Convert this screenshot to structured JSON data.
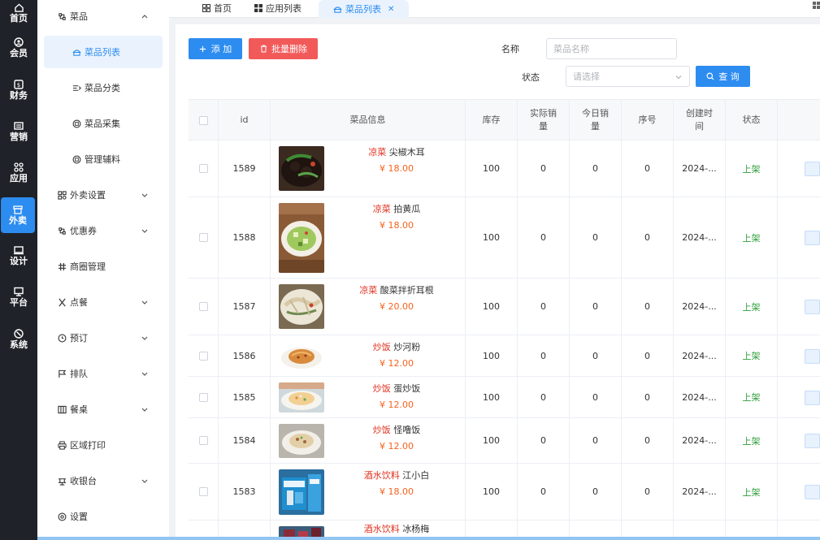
{
  "rail": [
    {
      "label": "首页",
      "icon": "home-icon"
    },
    {
      "label": "会员",
      "icon": "member-icon"
    },
    {
      "label": "财务",
      "icon": "finance-icon"
    },
    {
      "label": "营销",
      "icon": "marketing-icon"
    },
    {
      "label": "应用",
      "icon": "apps-icon"
    },
    {
      "label": "外卖",
      "icon": "takeout-icon",
      "active": true
    },
    {
      "label": "设计",
      "icon": "design-icon"
    },
    {
      "label": "平台",
      "icon": "platform-icon"
    },
    {
      "label": "系统",
      "icon": "system-icon"
    }
  ],
  "menu": {
    "group_dishes": "菜品",
    "sub": [
      "菜品列表",
      "菜品分类",
      "菜品采集",
      "管理辅料"
    ],
    "items": [
      "外卖设置",
      "优惠券",
      "商圈管理",
      "点餐",
      "预订",
      "排队",
      "餐桌",
      "区域打印",
      "收银台",
      "设置"
    ]
  },
  "tabs": [
    "首页",
    "应用列表",
    "菜品列表"
  ],
  "toolbar": {
    "add_label": "添 加",
    "batch_delete_label": "批量删除",
    "name_label": "名称",
    "name_placeholder": "菜品名称",
    "status_label": "状态",
    "status_placeholder": "请选择",
    "query_label": "查 询"
  },
  "table": {
    "headers": {
      "id": "id",
      "info": "菜品信息",
      "stock": "库存",
      "actual_sales": "实际销量",
      "today_sales": "今日销量",
      "sort": "序号",
      "created": "创建时间",
      "status": "状态"
    },
    "rows": [
      {
        "id": "1589",
        "category": "凉菜",
        "name": "尖椒木耳",
        "price": "¥ 18.00",
        "stock": "100",
        "actual": "0",
        "today": "0",
        "sort": "0",
        "created": "2024-...",
        "status": "上架"
      },
      {
        "id": "1588",
        "category": "凉菜",
        "name": "拍黄瓜",
        "price": "¥ 18.00",
        "stock": "100",
        "actual": "0",
        "today": "0",
        "sort": "0",
        "created": "2024-...",
        "status": "上架"
      },
      {
        "id": "1587",
        "category": "凉菜",
        "name": "酸菜拌折耳根",
        "price": "¥ 20.00",
        "stock": "100",
        "actual": "0",
        "today": "0",
        "sort": "0",
        "created": "2024-...",
        "status": "上架"
      },
      {
        "id": "1586",
        "category": "炒饭",
        "name": "炒河粉",
        "price": "¥ 12.00",
        "stock": "100",
        "actual": "0",
        "today": "0",
        "sort": "0",
        "created": "2024-...",
        "status": "上架"
      },
      {
        "id": "1585",
        "category": "炒饭",
        "name": "蛋炒饭",
        "price": "¥ 12.00",
        "stock": "100",
        "actual": "0",
        "today": "0",
        "sort": "0",
        "created": "2024-...",
        "status": "上架"
      },
      {
        "id": "1584",
        "category": "炒饭",
        "name": "怪噜饭",
        "price": "¥ 12.00",
        "stock": "100",
        "actual": "0",
        "today": "0",
        "sort": "0",
        "created": "2024-...",
        "status": "上架"
      },
      {
        "id": "1583",
        "category": "酒水饮料",
        "name": "江小白",
        "price": "¥ 18.00",
        "stock": "100",
        "actual": "0",
        "today": "0",
        "sort": "0",
        "created": "2024-...",
        "status": "上架"
      },
      {
        "id": "",
        "category": "酒水饮料",
        "name": "冰杨梅",
        "price": "",
        "stock": "",
        "actual": "",
        "today": "",
        "sort": "",
        "created": "",
        "status": ""
      }
    ]
  },
  "colors": {
    "primary": "#2d8cf0",
    "danger": "#f25a5a",
    "rail_bg": "#1f2329",
    "status_green": "#2e9e3a",
    "category_red": "#e0301e",
    "price_orange": "#f5621e"
  }
}
